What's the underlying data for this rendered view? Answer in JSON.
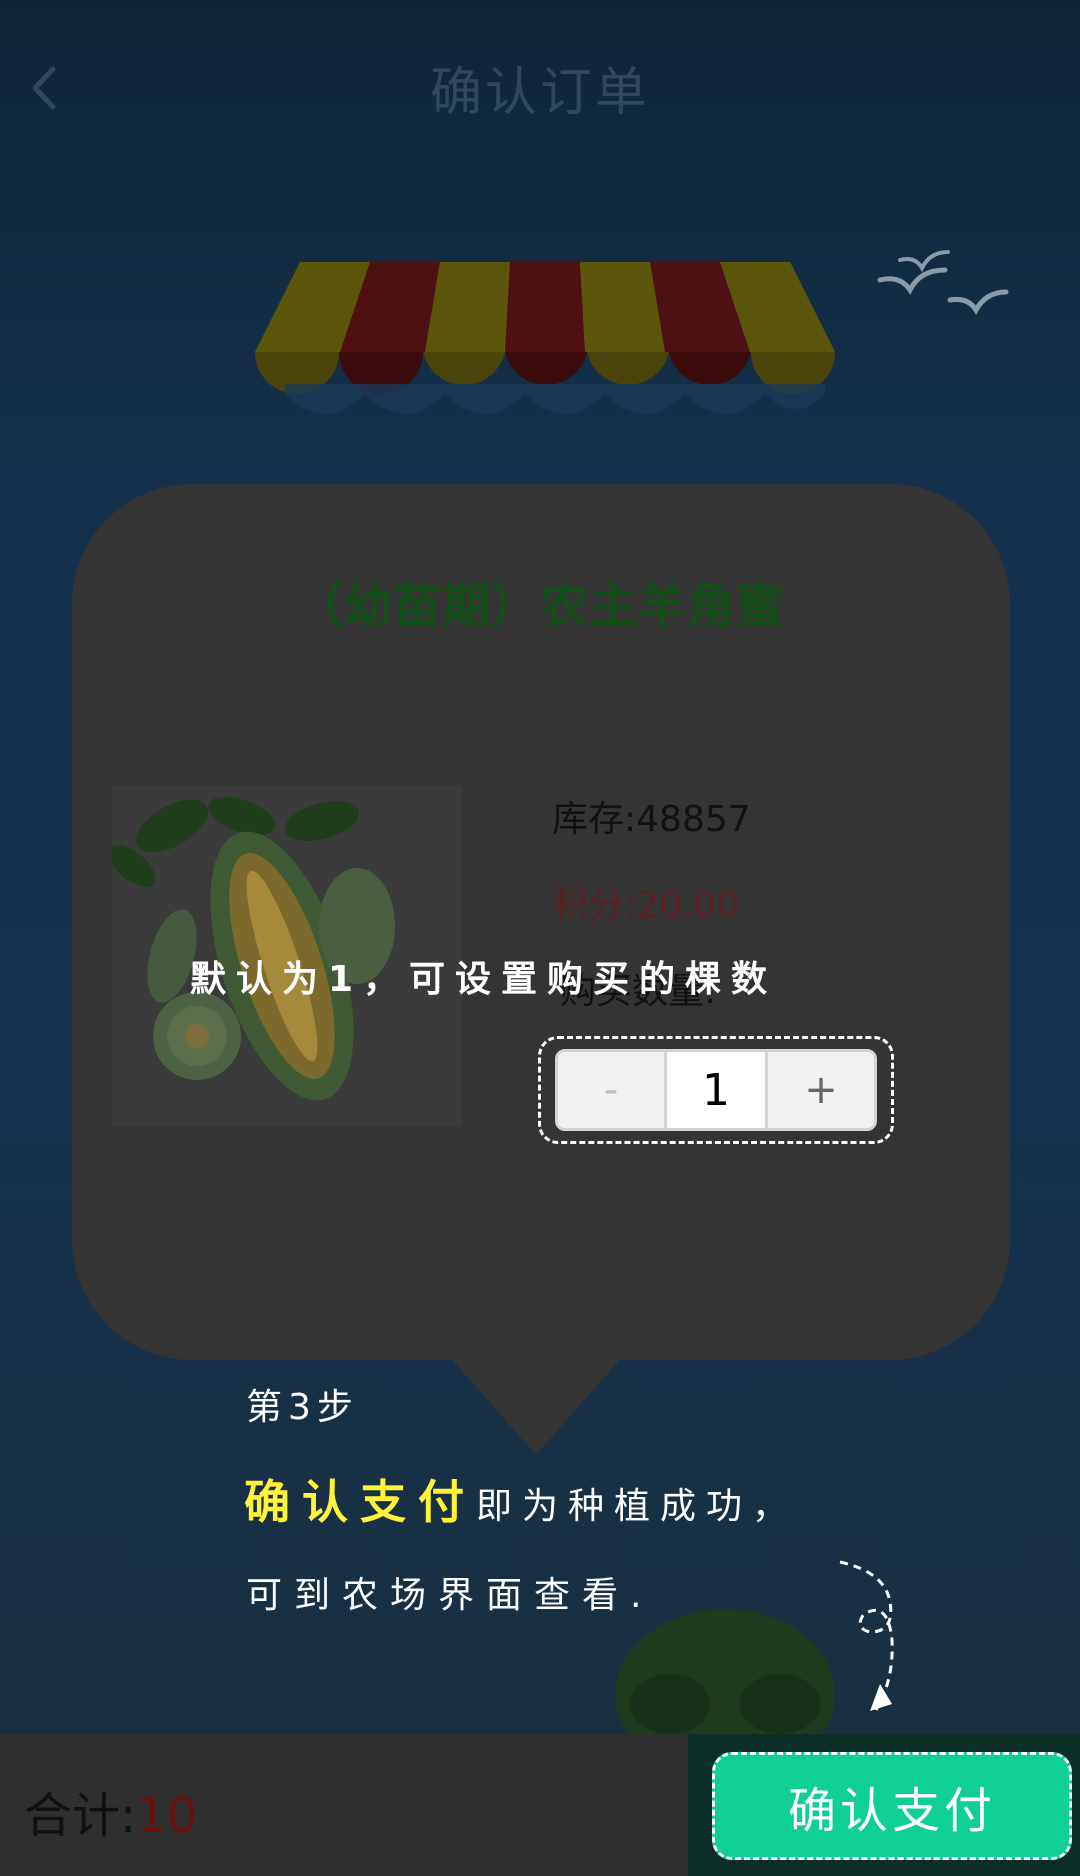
{
  "header": {
    "title": "确认订单",
    "back_icon": "chevron-left-icon"
  },
  "product": {
    "title": "（幼苗期）农主羊角蜜",
    "image": "melon-image",
    "stock": "库存:48857",
    "points": "积分:20.00",
    "quantity_label": "购买数量:"
  },
  "stepper": {
    "minus": "-",
    "value": "1",
    "plus": "+"
  },
  "guide": {
    "hint": "默认为1，可设置购买的棵数",
    "step": "第3步",
    "highlight": "确认支付",
    "line1_rest": "即为种植成功，",
    "line2": "可到农场界面查看."
  },
  "footer": {
    "total_label": "合计:",
    "total_value": "10",
    "pay_button": "确认支付"
  },
  "colors": {
    "accent": "#10cf95",
    "highlight": "#fff23a",
    "price": "#6b1010"
  }
}
